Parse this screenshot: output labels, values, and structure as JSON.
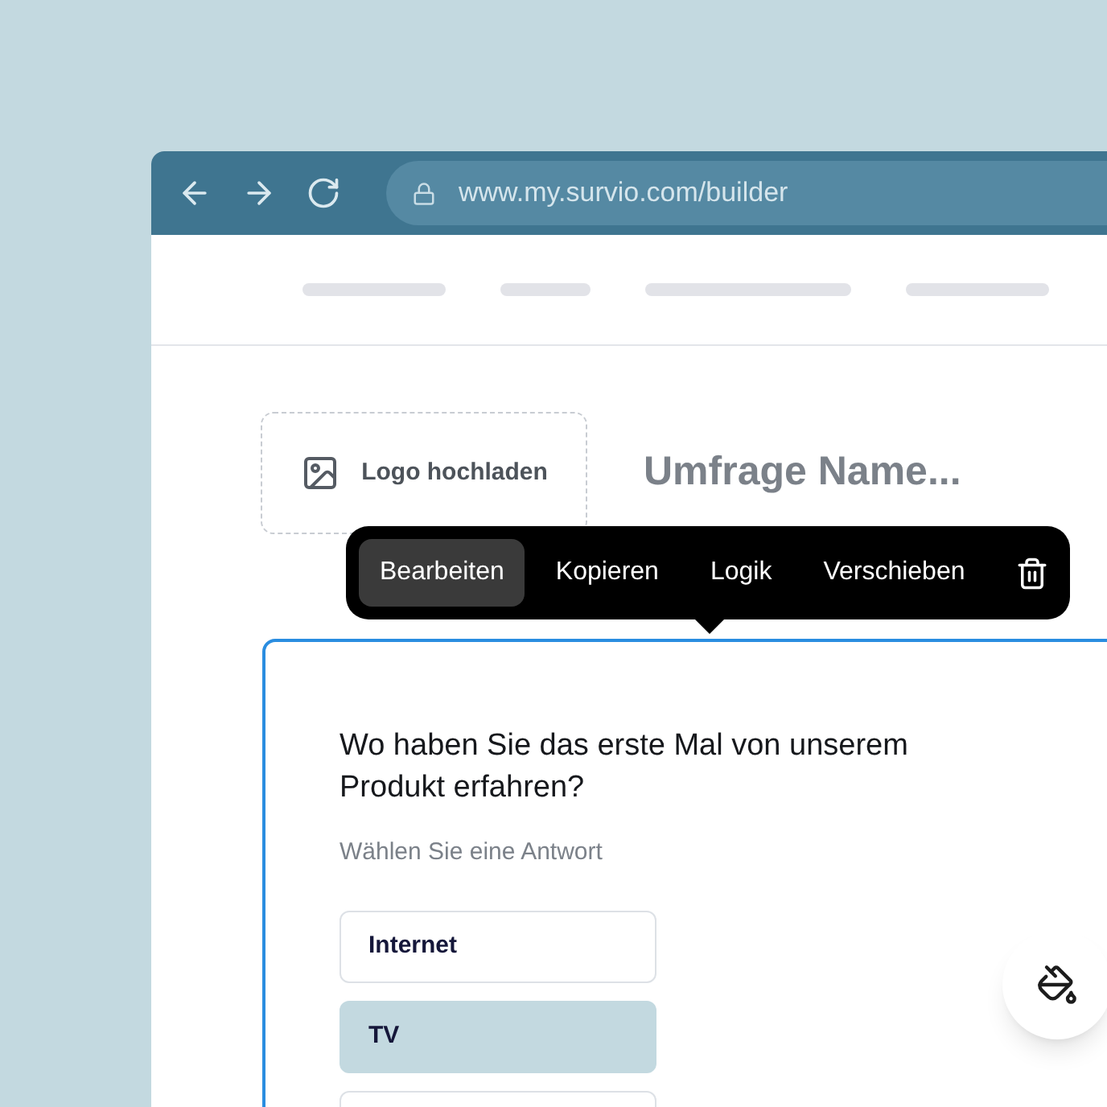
{
  "browser": {
    "url": "www.my.survio.com/builder"
  },
  "logo_upload": {
    "label": "Logo hochladen"
  },
  "survey_title": {
    "placeholder": "Umfrage Name..."
  },
  "toolbar": {
    "actions": [
      {
        "label": "Bearbeiten",
        "selected": true
      },
      {
        "label": "Kopieren",
        "selected": false
      },
      {
        "label": "Logik",
        "selected": false
      },
      {
        "label": "Verschieben",
        "selected": false
      }
    ]
  },
  "question": {
    "title": "Wo haben Sie das erste Mal von unserem Produkt erfahren?",
    "hint": "Wählen Sie eine Antwort",
    "answers": [
      {
        "label": "Internet",
        "selected": false
      },
      {
        "label": "TV",
        "selected": true
      },
      {
        "selected": false
      }
    ]
  }
}
